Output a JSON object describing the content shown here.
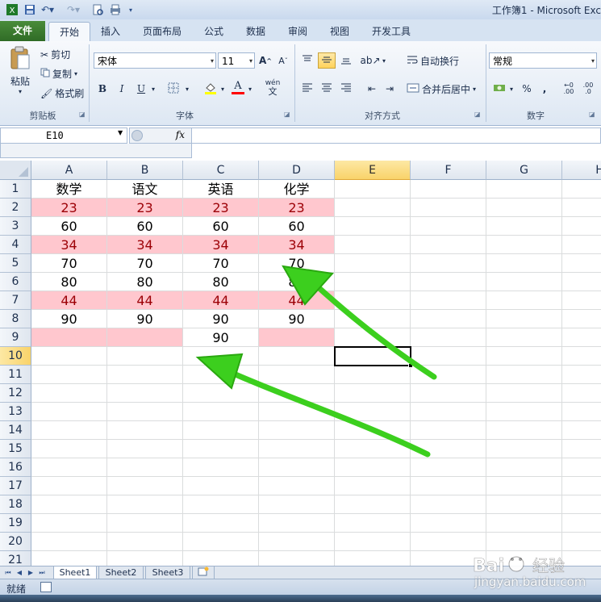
{
  "window": {
    "title": "工作簿1 - Microsoft Exc"
  },
  "ribbon_tabs": [
    "文件",
    "开始",
    "插入",
    "页面布局",
    "公式",
    "数据",
    "审阅",
    "视图",
    "开发工具"
  ],
  "clipboard": {
    "paste": "粘贴",
    "cut": "剪切",
    "copy": "复制",
    "format_painter": "格式刷",
    "group": "剪贴板"
  },
  "font": {
    "name": "宋体",
    "size": "11",
    "bold": "B",
    "italic": "I",
    "underline": "U",
    "font_color_letter": "A",
    "phonetic": "wén",
    "grow": "A",
    "shrink": "A",
    "group": "字体"
  },
  "alignment": {
    "wrap_text": "自动换行",
    "merge_center": "合并后居中",
    "group": "对齐方式"
  },
  "number": {
    "format": "常规",
    "percent": "%",
    "comma": ",",
    "inc_decimal": ".00",
    "dec_decimal": ".0",
    "group": "数字"
  },
  "formula_bar": {
    "name_box": "E10",
    "fx": "fx",
    "content": ""
  },
  "sheet": {
    "columns": [
      "A",
      "B",
      "C",
      "D",
      "E",
      "F",
      "G",
      "H"
    ],
    "active_column": "E",
    "rows": [
      "1",
      "2",
      "3",
      "4",
      "5",
      "6",
      "7",
      "8",
      "9",
      "10",
      "11",
      "12",
      "13",
      "14",
      "15",
      "16",
      "17",
      "18",
      "19",
      "20",
      "21"
    ],
    "active_row": "10",
    "active_cell": "E10",
    "cells": [
      [
        "数学",
        "语文",
        "英语",
        "化学"
      ],
      [
        "23",
        "23",
        "23",
        "23"
      ],
      [
        "60",
        "60",
        "60",
        "60"
      ],
      [
        "34",
        "34",
        "34",
        "34"
      ],
      [
        "70",
        "70",
        "70",
        "70"
      ],
      [
        "80",
        "80",
        "80",
        "80"
      ],
      [
        "44",
        "44",
        "44",
        "44"
      ],
      [
        "90",
        "90",
        "90",
        "90"
      ],
      [
        "",
        "",
        "90",
        ""
      ]
    ],
    "highlight_colors": {
      "fill": "#ffc7ce",
      "text": "#9c0006"
    },
    "highlighted_cells": [
      [
        2,
        0
      ],
      [
        2,
        1
      ],
      [
        2,
        2
      ],
      [
        2,
        3
      ],
      [
        4,
        0
      ],
      [
        4,
        1
      ],
      [
        4,
        2
      ],
      [
        4,
        3
      ],
      [
        7,
        0
      ],
      [
        7,
        1
      ],
      [
        7,
        2
      ],
      [
        7,
        3
      ],
      [
        9,
        0
      ],
      [
        9,
        1
      ],
      [
        9,
        3
      ]
    ]
  },
  "sheet_tabs": [
    "Sheet1",
    "Sheet2",
    "Sheet3"
  ],
  "active_sheet": "Sheet1",
  "status": {
    "ready": "就绪"
  },
  "annotations": {
    "arrow_color": "#3ccf1e",
    "arrows": 2
  },
  "watermark": {
    "logo_text": "Bai 经验",
    "site": "jingyan.baidu.com"
  }
}
